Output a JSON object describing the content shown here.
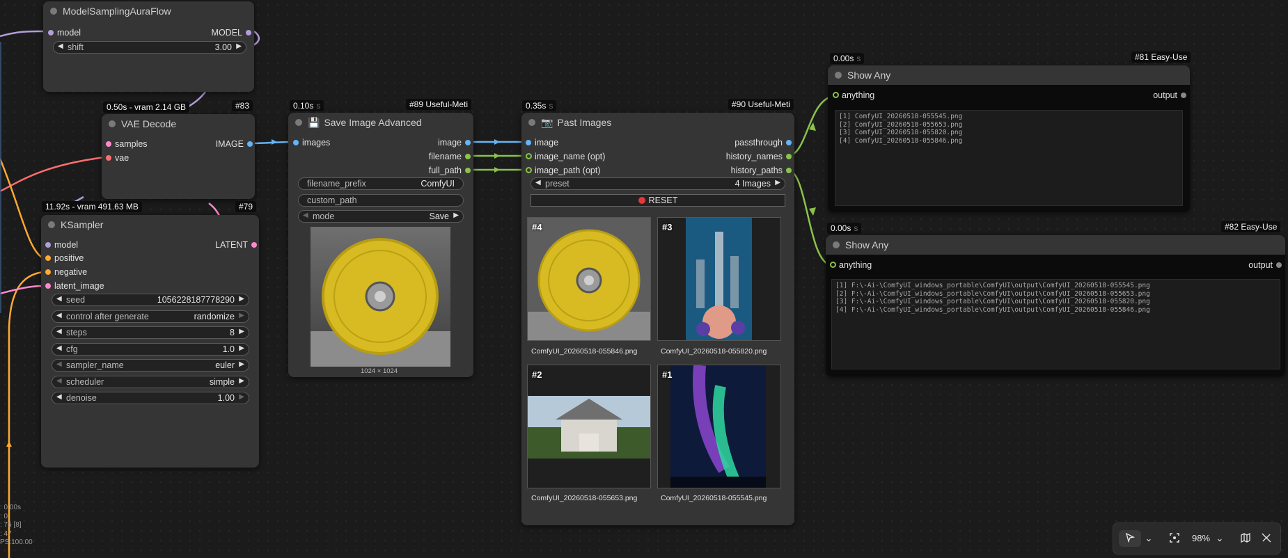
{
  "nodes": {
    "model_sampling": {
      "title": "ModelSamplingAuraFlow",
      "inputs": [
        "model"
      ],
      "outputs": [
        "MODEL"
      ],
      "widgets": [
        {
          "label": "shift",
          "value": "3.00"
        }
      ]
    },
    "vae_decode": {
      "title": "VAE Decode",
      "timing": "0.50s - vram 2.14 GB",
      "id": "#83",
      "inputs": [
        "samples",
        "vae"
      ],
      "outputs": [
        "IMAGE"
      ]
    },
    "ksampler": {
      "title": "KSampler",
      "timing": "11.92s - vram 491.63 MB",
      "id": "#79",
      "inputs": [
        "model",
        "positive",
        "negative",
        "latent_image"
      ],
      "outputs": [
        "LATENT"
      ],
      "widgets": [
        {
          "label": "seed",
          "value": "1056228187778290"
        },
        {
          "label": "control after generate",
          "value": "randomize"
        },
        {
          "label": "steps",
          "value": "8"
        },
        {
          "label": "cfg",
          "value": "1.0"
        },
        {
          "label": "sampler_name",
          "value": "euler"
        },
        {
          "label": "scheduler",
          "value": "simple"
        },
        {
          "label": "denoise",
          "value": "1.00"
        }
      ]
    },
    "save_image": {
      "title": "Save Image Advanced",
      "icon": "floppy-disk-icon",
      "timing": "0.10s",
      "id": "#89 Useful-Meti",
      "inputs": [
        "images"
      ],
      "outputs": [
        "image",
        "filename",
        "full_path"
      ],
      "widgets": [
        {
          "label": "filename_prefix",
          "value": "ComfyUI"
        },
        {
          "label": "custom_path",
          "value": ""
        },
        {
          "label": "mode",
          "value": "Save"
        }
      ],
      "preview_size": "1024 × 1024"
    },
    "past_images": {
      "title": "Past Images",
      "icon": "camera-icon",
      "timing": "0.35s",
      "id": "#90 Useful-Meti",
      "inputs": [
        "image",
        "image_name (opt)",
        "image_path (opt)"
      ],
      "outputs": [
        "passthrough",
        "history_names",
        "history_paths"
      ],
      "preset": {
        "label": "preset",
        "value": "4 Images"
      },
      "reset_label": "RESET",
      "thumbs": [
        {
          "tag": "#4",
          "caption": "ComfyUI_20260518-055846.png"
        },
        {
          "tag": "#3",
          "caption": "ComfyUI_20260518-055820.png"
        },
        {
          "tag": "#2",
          "caption": "ComfyUI_20260518-055653.png"
        },
        {
          "tag": "#1",
          "caption": "ComfyUI_20260518-055545.png"
        }
      ]
    },
    "show_any_1": {
      "title": "Show Any",
      "timing": "0.00s",
      "id": "#81 Easy-Use",
      "input": "anything",
      "output": "output",
      "lines": [
        "[1] ComfyUI_20260518-055545.png",
        "[2] ComfyUI_20260518-055653.png",
        "[3] ComfyUI_20260518-055820.png",
        "[4] ComfyUI_20260518-055846.png"
      ]
    },
    "show_any_2": {
      "title": "Show Any",
      "timing": "0.00s",
      "id": "#82 Easy-Use",
      "input": "anything",
      "output": "output",
      "lines": [
        "[1] F:\\-Ai-\\ComfyUI_windows_portable\\ComfyUI\\output\\ComfyUI_20260518-055545.png",
        "[2] F:\\-Ai-\\ComfyUI_windows_portable\\ComfyUI\\output\\ComfyUI_20260518-055653.png",
        "[3] F:\\-Ai-\\ComfyUI_windows_portable\\ComfyUI\\output\\ComfyUI_20260518-055820.png",
        "[4] F:\\-Ai-\\ComfyUI_windows_portable\\ComfyUI\\output\\ComfyUI_20260518-055846.png"
      ]
    }
  },
  "stats": [
    ": 0.00s",
    ": 0",
    ": 75 [8]",
    ": 47",
    "PS:100.00"
  ],
  "toolbar": {
    "zoom": "98%",
    "icons": [
      "pointer-icon",
      "chevron-down-icon",
      "fit-view-icon",
      "chevron-down-icon",
      "minimap-icon",
      "hide-links-icon"
    ]
  },
  "colors": {
    "canvas": "#1b1b1b",
    "node_bg": "#353535",
    "model_link": "#b39ddb",
    "vae_link": "#ff6e6e",
    "image_link": "#64b5f6",
    "string_link": "#8bc34a",
    "conditioning_link": "#ffa931",
    "latent_link": "#ff88cc"
  }
}
